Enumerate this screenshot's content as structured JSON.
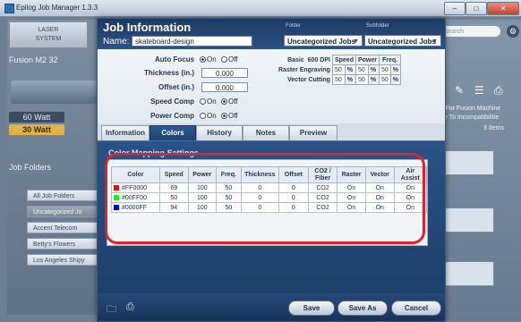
{
  "window": {
    "title": "Epilog Job Manager 1.3.3",
    "min": "–",
    "max": "□",
    "close": "✕"
  },
  "background": {
    "tab_laser": "LASER",
    "tab_system": "SYSTEM",
    "machine": "Fusion M2 32",
    "watt_60": "60 Watt",
    "watt_30": "30 Watt",
    "folders_header": "Job Folders",
    "folders": [
      "All Job Folders",
      "Uncategorized Jo",
      "Accent Telecom",
      "Betty's Flowers",
      "Los Angeles Shipy"
    ],
    "search_placeholder": "search",
    "right_text_1": "s For Fusion Machine",
    "right_text_2": "ue To Incompatibilitie",
    "right_count": "3 Items"
  },
  "dialog": {
    "title": "Job Information",
    "name_label": "Name:",
    "name_value": "skateboard-design",
    "folder_label": "Folder",
    "folder_value": "Uncategorized Jobs",
    "subfolder_label": "Subfolder",
    "subfolder_value": "Uncategorized Jobs"
  },
  "settings": {
    "auto_focus_label": "Auto Focus",
    "on_label": "On",
    "off_label": "Off",
    "thickness_label": "Thickness (in.)",
    "thickness_value": "0.000",
    "offset_label": "Offset (in.)",
    "offset_value": "0.000",
    "speed_comp_label": "Speed Comp",
    "power_comp_label": "Power Comp",
    "mode_label": "Basic",
    "dpi": "600 DPI",
    "col_speed": "Speed",
    "col_power": "Power",
    "col_freq": "Freq.",
    "raster_label": "Raster Engraving",
    "vector_label": "Vector Cutting",
    "raster_speed": "50",
    "raster_power": "50",
    "raster_freq": "50",
    "vector_speed": "50",
    "vector_power": "50",
    "vector_freq": "50",
    "pct": "%"
  },
  "tabs": [
    "Information",
    "Colors",
    "History",
    "Notes",
    "Preview"
  ],
  "color_mapping": {
    "title": "Color Mapping Settings",
    "headers": [
      "Color",
      "Speed",
      "Power",
      "Freq.",
      "Thickness",
      "Offset",
      "CO2 / Fiber",
      "Raster",
      "Vector",
      "Air Assist"
    ],
    "rows": [
      {
        "swatch": "#FF0000",
        "color": "#FF0000",
        "speed": "69",
        "power": "100",
        "freq": "50",
        "thickness": "0",
        "offset": "0",
        "laser": "CO2",
        "raster": "On",
        "vector": "On",
        "air": "On"
      },
      {
        "swatch": "#00FF00",
        "color": "#00FF00",
        "speed": "50",
        "power": "100",
        "freq": "50",
        "thickness": "0",
        "offset": "0",
        "laser": "CO2",
        "raster": "On",
        "vector": "On",
        "air": "On"
      },
      {
        "swatch": "#0000FF",
        "color": "#0000FF",
        "speed": "94",
        "power": "100",
        "freq": "50",
        "thickness": "0",
        "offset": "0",
        "laser": "CO2",
        "raster": "On",
        "vector": "On",
        "air": "On"
      }
    ],
    "highlight_color": "#E0202A"
  },
  "footer": {
    "save": "Save",
    "save_as": "Save As",
    "cancel": "Cancel"
  }
}
